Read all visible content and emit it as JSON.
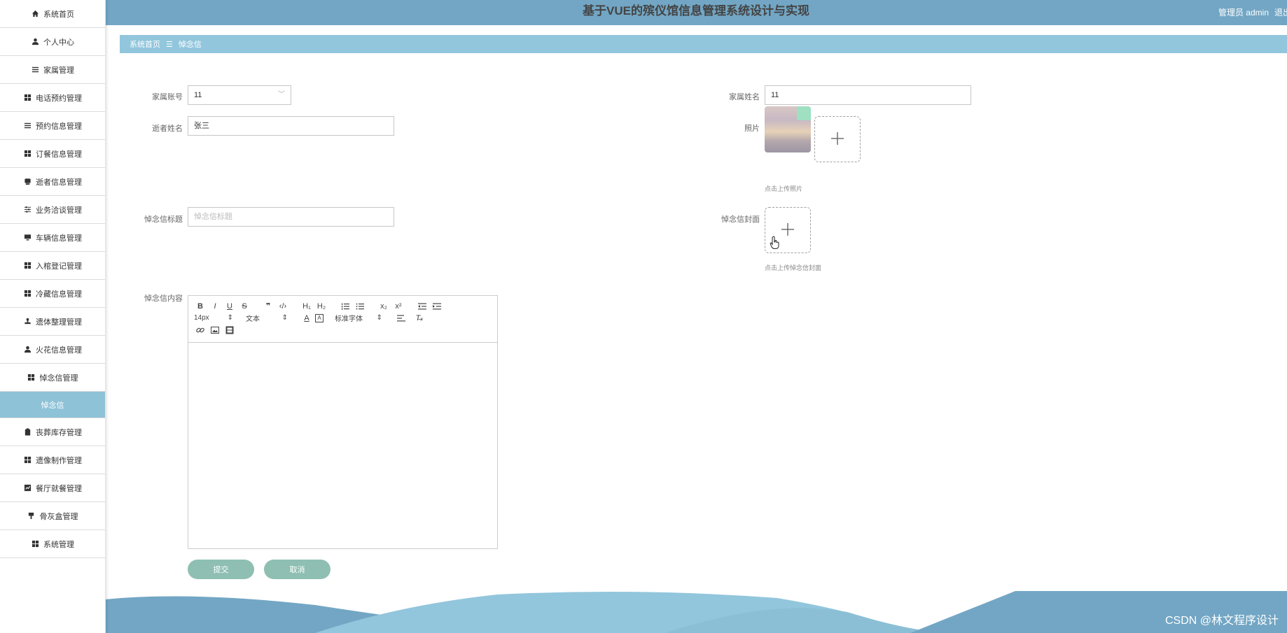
{
  "app": {
    "title": "基于VUE的殡仪馆信息管理系统设计与实现",
    "user": "管理员 admin",
    "logout": "退出"
  },
  "sidebar": {
    "items": [
      {
        "label": "系统首页",
        "icon": "home-icon"
      },
      {
        "label": "个人中心",
        "icon": "user-icon"
      },
      {
        "label": "家属管理",
        "icon": "list-icon"
      },
      {
        "label": "电话预约管理",
        "icon": "grid-icon"
      },
      {
        "label": "预约信息管理",
        "icon": "list-icon"
      },
      {
        "label": "订餐信息管理",
        "icon": "grid-icon"
      },
      {
        "label": "逝者信息管理",
        "icon": "box-icon"
      },
      {
        "label": "业务洽谈管理",
        "icon": "sliders-icon"
      },
      {
        "label": "车辆信息管理",
        "icon": "monitor-icon"
      },
      {
        "label": "入棺登记管理",
        "icon": "grid-icon"
      },
      {
        "label": "冷藏信息管理",
        "icon": "grid-icon"
      },
      {
        "label": "遗体整理管理",
        "icon": "stamp-icon"
      },
      {
        "label": "火花信息管理",
        "icon": "user-icon"
      },
      {
        "label": "悼念信管理",
        "icon": "grid-icon"
      }
    ],
    "active_sub": "悼念信",
    "items_after": [
      {
        "label": "丧葬库存管理",
        "icon": "clipboard-icon"
      },
      {
        "label": "遗像制作管理",
        "icon": "grid-icon"
      },
      {
        "label": "餐厅就餐管理",
        "icon": "chart-icon"
      },
      {
        "label": "骨灰盒管理",
        "icon": "pin-icon"
      },
      {
        "label": "系统管理",
        "icon": "grid-icon"
      }
    ]
  },
  "breadcrumb": {
    "home": "系统首页",
    "sep": "☰",
    "current": "悼念信"
  },
  "form": {
    "family_account_label": "家属账号",
    "family_account_value": "11",
    "family_name_label": "家属姓名",
    "family_name_value": "11",
    "deceased_name_label": "逝者姓名",
    "deceased_name_value": "张三",
    "photo_label": "照片",
    "photo_hint": "点击上传照片",
    "letter_title_label": "悼念信标题",
    "letter_title_placeholder": "悼念信标题",
    "cover_label": "悼念信封面",
    "cover_hint": "点击上传悼念信封面",
    "content_label": "悼念信内容"
  },
  "editor": {
    "font_size": "14px",
    "text_style": "文本",
    "font_family": "标准字体"
  },
  "buttons": {
    "submit": "提交",
    "cancel": "取消"
  },
  "watermark": "CSDN @林文程序设计",
  "colors": {
    "topbar": "#72a6c4",
    "breadcrumb": "#92c6dc",
    "active_sub": "#8ec2d6",
    "button": "#8ebfb2"
  }
}
